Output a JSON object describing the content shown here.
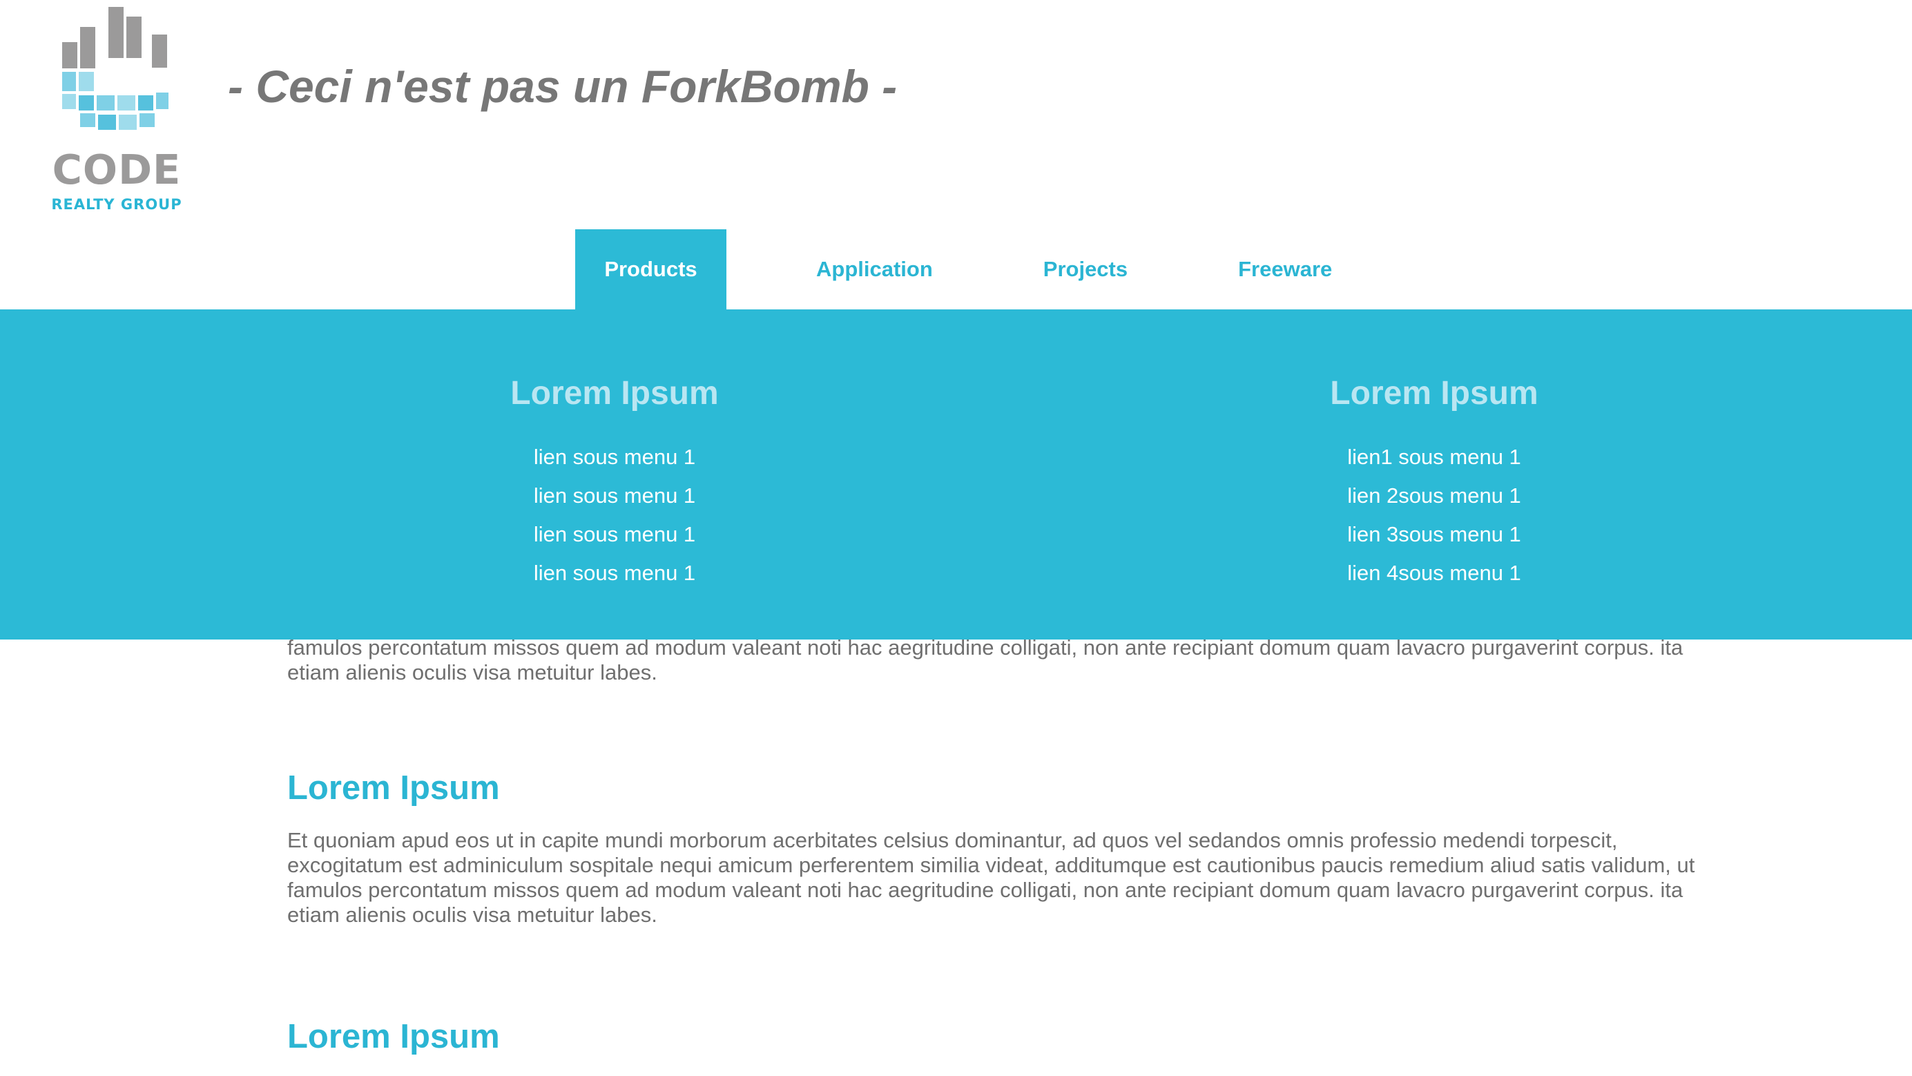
{
  "header": {
    "logo_word": "CODE",
    "logo_sub": "REALTY GROUP",
    "tagline": "- Ceci n'est pas un ForkBomb -"
  },
  "nav": {
    "items": [
      {
        "label": "Products",
        "active": true
      },
      {
        "label": "Application",
        "active": false
      },
      {
        "label": "Projects",
        "active": false
      },
      {
        "label": "Freeware",
        "active": false
      }
    ]
  },
  "mega_menu": {
    "columns": [
      {
        "title": "Lorem Ipsum",
        "links": [
          "lien sous menu 1",
          "lien sous menu 1",
          "lien sous menu 1",
          "lien sous menu 1"
        ]
      },
      {
        "title": "Lorem Ipsum",
        "links": [
          "lien1 sous menu 1",
          "lien 2sous menu 1",
          "lien 3sous menu 1",
          "lien 4sous menu 1"
        ]
      }
    ]
  },
  "content": {
    "partial_para": {
      "line1": "famulos percontatum missos quem ad modum valeant noti hac aegritudine colligati, non ante recipiant domum quam lavacro purgaverint corpus. ita",
      "line2": "etiam alienis oculis visa metuitur labes."
    },
    "sections": [
      {
        "title": "Lorem Ipsum",
        "lines": [
          "Et quoniam apud eos ut in capite mundi morborum acerbitates celsius dominantur, ad quos vel sedandos omnis professio medendi torpescit,",
          "excogitatum est adminiculum sospitale nequi amicum perferentem similia videat, additumque est cautionibus paucis remedium aliud satis validum, ut",
          "famulos percontatum missos quem ad modum valeant noti hac aegritudine colligati, non ante recipiant domum quam lavacro purgaverint corpus. ita",
          "etiam alienis oculis visa metuitur labes."
        ]
      },
      {
        "title": "Lorem Ipsum",
        "lines": []
      }
    ]
  },
  "colors": {
    "accent": "#2cbad6",
    "accent_text": "#2bb5d3",
    "menu_title": "#b9e6f2",
    "body_text": "#6f6f6f",
    "tagline": "#777777",
    "logo_grey": "#9b9a9a",
    "logo_blue": "#7fd0e6"
  }
}
